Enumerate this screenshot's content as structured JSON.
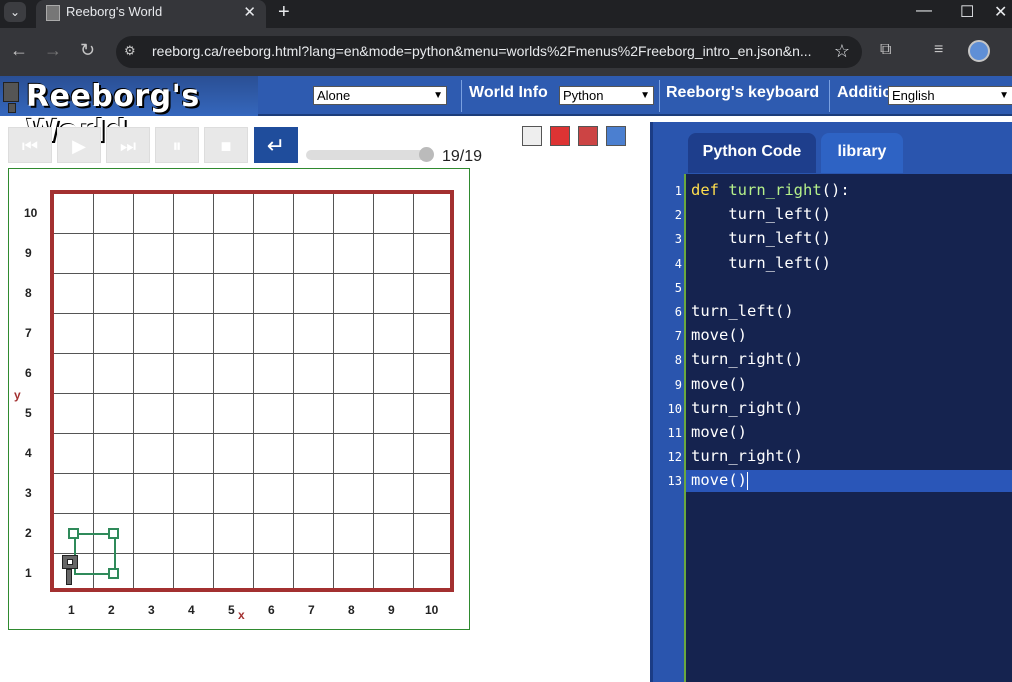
{
  "browser": {
    "tab_title": "Reeborg's World",
    "url": "reeborg.ca/reeborg.html?lang=en&mode=python&menu=worlds%2Fmenus%2Freeborg_intro_en.json&n..."
  },
  "header": {
    "logo_text": "Reeborg's World",
    "world_select": "Alone",
    "world_info": "World Info",
    "language_select": "Python",
    "keyboard": "Reeborg's keyboard",
    "additional": "Additic",
    "ui_language_select": "English"
  },
  "controls": {
    "step_counter": "19/19",
    "slider_fraction": 1.0
  },
  "world": {
    "y_labels": [
      "10",
      "9",
      "8",
      "7",
      "6",
      "5",
      "4",
      "3",
      "2",
      "1"
    ],
    "x_labels": [
      "1",
      "2",
      "3",
      "4",
      "5",
      "6",
      "7",
      "8",
      "9",
      "10"
    ],
    "x_axis_name": "x",
    "y_axis_name": "y"
  },
  "editor": {
    "tab_code": "Python Code",
    "tab_library": "library",
    "line_numbers": [
      "1",
      "2",
      "3",
      "4",
      "5",
      "6",
      "7",
      "8",
      "9",
      "10",
      "11",
      "12",
      "13"
    ],
    "lines": [
      {
        "kw": "def ",
        "fn": "turn_right",
        "rest": "():"
      },
      {
        "text": "    turn_left()"
      },
      {
        "text": "    turn_left()"
      },
      {
        "text": "    turn_left()"
      },
      {
        "text": ""
      },
      {
        "text": "turn_left()"
      },
      {
        "text": "move()"
      },
      {
        "text": "turn_right()"
      },
      {
        "text": "move()"
      },
      {
        "text": "turn_right()"
      },
      {
        "text": "move()"
      },
      {
        "text": "turn_right()"
      },
      {
        "text": "move()"
      }
    ]
  },
  "colors": {
    "header_blue": "#2e5bb0",
    "wall_red": "#a33030",
    "trace_green": "#2f8a5a",
    "editor_bg": "#15234f"
  }
}
